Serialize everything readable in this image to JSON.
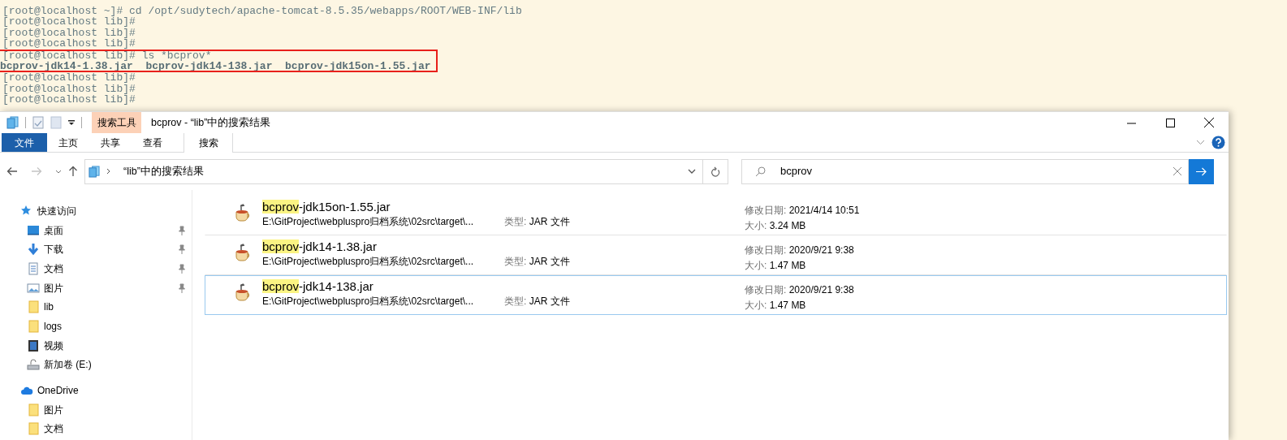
{
  "terminal": {
    "lines": [
      {
        "kind": "prompt",
        "text": "[root@localhost ~]# cd /opt/sudytech/apache-tomcat-8.5.35/webapps/ROOT/WEB-INF/lib",
        "highlighted": false
      },
      {
        "kind": "prompt",
        "text": "[root@localhost lib]#",
        "highlighted": false
      },
      {
        "kind": "prompt",
        "text": "[root@localhost lib]#",
        "highlighted": false
      },
      {
        "kind": "prompt",
        "text": "[root@localhost lib]#",
        "highlighted": false
      },
      {
        "kind": "prompt",
        "text": "[root@localhost lib]# ls *bcprov*",
        "highlighted": true
      },
      {
        "kind": "listing",
        "text": "bcprov-jdk14-1.38.jar  bcprov-jdk14-138.jar  bcprov-jdk15on-1.55.jar",
        "highlighted": true
      },
      {
        "kind": "prompt",
        "text": "[root@localhost lib]#",
        "highlighted": false
      },
      {
        "kind": "prompt",
        "text": "[root@localhost lib]#",
        "highlighted": false
      },
      {
        "kind": "prompt",
        "text": "[root@localhost lib]#",
        "highlighted": false
      }
    ]
  },
  "window": {
    "title": "bcprov - “lib”中的搜索结果",
    "context_tab": "搜索工具",
    "ribbon_tabs": [
      {
        "kind": "file",
        "label": "文件",
        "selected": false
      },
      {
        "kind": "tab",
        "label": "主页",
        "selected": false
      },
      {
        "kind": "tab",
        "label": "共享",
        "selected": false
      },
      {
        "kind": "tab",
        "label": "查看",
        "selected": false
      },
      {
        "kind": "context",
        "label": "搜索",
        "selected": true
      }
    ],
    "address": "“lib”中的搜索结果",
    "search": {
      "value": "bcprov"
    },
    "sidebar": [
      {
        "kind": "star",
        "label": "快速访问",
        "children": [
          {
            "kind": "desktop",
            "label": "桌面",
            "pinned": true
          },
          {
            "kind": "downloads",
            "label": "下载",
            "pinned": true
          },
          {
            "kind": "documents",
            "label": "文档",
            "pinned": true
          },
          {
            "kind": "pictures",
            "label": "图片",
            "pinned": true
          },
          {
            "kind": "folder",
            "label": "lib",
            "pinned": false
          },
          {
            "kind": "folder",
            "label": "logs",
            "pinned": false
          },
          {
            "kind": "videos",
            "label": "视频",
            "pinned": false
          },
          {
            "kind": "drive",
            "label": "新加卷 (E:)",
            "pinned": false
          }
        ]
      },
      {
        "kind": "cloud",
        "label": "OneDrive",
        "children": [
          {
            "kind": "folder",
            "label": "图片",
            "pinned": false
          },
          {
            "kind": "folder",
            "label": "文档",
            "pinned": false
          }
        ]
      }
    ],
    "files": [
      {
        "name_match": "bcprov",
        "name_rest": "-jdk15on-1.55.jar",
        "path": "E:\\GitProject\\webpluspro归档系统\\02src\\target\\...",
        "type_label": "类型:",
        "type": "JAR 文件",
        "date_label": "修改日期:",
        "date": "2021/4/14 10:51",
        "size_label": "大小:",
        "size": "3.24 MB",
        "selected": false
      },
      {
        "name_match": "bcprov",
        "name_rest": "-jdk14-1.38.jar",
        "path": "E:\\GitProject\\webpluspro归档系统\\02src\\target\\...",
        "type_label": "类型:",
        "type": "JAR 文件",
        "date_label": "修改日期:",
        "date": "2020/9/21 9:38",
        "size_label": "大小:",
        "size": "1.47 MB",
        "selected": false
      },
      {
        "name_match": "bcprov",
        "name_rest": "-jdk14-138.jar",
        "path": "E:\\GitProject\\webpluspro归档系统\\02src\\target\\...",
        "type_label": "类型:",
        "type": "JAR 文件",
        "date_label": "修改日期:",
        "date": "2020/9/21 9:38",
        "size_label": "大小:",
        "size": "1.47 MB",
        "selected": true
      }
    ]
  }
}
